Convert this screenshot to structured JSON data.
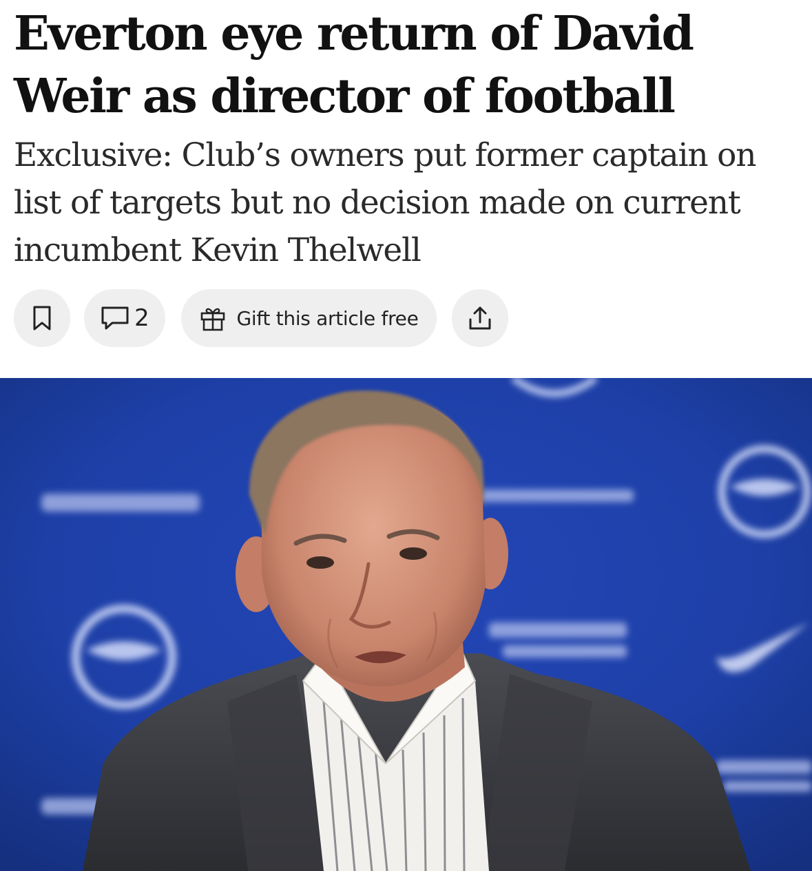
{
  "article": {
    "headline": "Everton eye return of David Weir as director of football",
    "standfirst": "Exclusive: Club’s owners put former captain on list of targets but no decision made on current incumbent Kevin Thelwell"
  },
  "actions": {
    "bookmark_icon": "bookmark-icon",
    "comment_icon": "comment-icon",
    "comment_count": "2",
    "gift_icon": "gift-icon",
    "gift_label": "Gift this article free",
    "share_icon": "share-icon"
  },
  "photo": {
    "subject": "man in dark jacket and striped shirt speaking at a press conference in front of a blue sponsor backdrop"
  },
  "colors": {
    "headline": "#111111",
    "standfirst": "#2a2a2a",
    "pill_bg": "#efefef",
    "backdrop_blue": "#1d3fa6"
  }
}
